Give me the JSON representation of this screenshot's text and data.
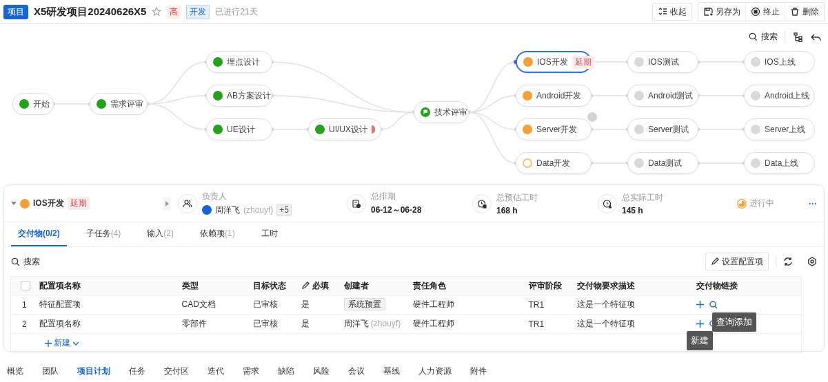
{
  "header": {
    "badge": "项目",
    "title": "X5研发项目20240626X5",
    "starred": false,
    "tags": [
      {
        "text": "高",
        "kind": "priority"
      },
      {
        "text": "开发",
        "kind": "phase"
      }
    ],
    "elapsed": "已进行21天",
    "actions": [
      {
        "label": "收起"
      },
      {
        "label": "另存为"
      },
      {
        "label": "终止"
      },
      {
        "label": "删除"
      }
    ]
  },
  "canvas_toolbar": {
    "search": "搜索"
  },
  "flow": {
    "nodes": [
      {
        "label": "开始",
        "kind": "task",
        "color": "#22a31a",
        "hollow": false,
        "selected": false,
        "warning": false,
        "comment": false
      },
      {
        "label": "需求评审",
        "kind": "task",
        "color": "#22a31a",
        "hollow": false,
        "selected": false,
        "warning": false,
        "comment": false
      },
      {
        "label": "埋点设计",
        "kind": "task",
        "color": "#22a31a",
        "hollow": false,
        "selected": false,
        "warning": false,
        "comment": false
      },
      {
        "label": "AB方案设计",
        "kind": "task",
        "color": "#22a31a",
        "hollow": false,
        "selected": false,
        "warning": false,
        "comment": false
      },
      {
        "label": "UE设计",
        "kind": "task",
        "color": "#22a31a",
        "hollow": false,
        "selected": false,
        "warning": false,
        "comment": false
      },
      {
        "label": "UI/UX设计",
        "kind": "task",
        "color": "#22a31a",
        "hollow": false,
        "selected": false,
        "warning": true,
        "comment": false
      },
      {
        "label": "技术评审",
        "kind": "milestone",
        "color": "#22a31a",
        "hollow": false,
        "selected": false,
        "warning": false,
        "comment": false
      },
      {
        "label": "IOS开发",
        "kind": "task",
        "color": "#f7a035",
        "hollow": false,
        "selected": true,
        "tag": "延期",
        "warning": false,
        "comment": false
      },
      {
        "label": "Android开发",
        "kind": "task",
        "color": "#f7a035",
        "hollow": false,
        "selected": false,
        "warning": false,
        "comment": false
      },
      {
        "label": "Server开发",
        "kind": "task",
        "color": "#f7a035",
        "hollow": false,
        "selected": false,
        "warning": false,
        "comment": true
      },
      {
        "label": "Data开发",
        "kind": "task",
        "color": "#f5c27a",
        "hollow": true,
        "selected": false,
        "warning": false,
        "comment": false
      },
      {
        "label": "IOS测试",
        "kind": "task",
        "color": "#d9d9d9",
        "hollow": false,
        "selected": false,
        "warning": false,
        "comment": false
      },
      {
        "label": "Android测试",
        "kind": "task",
        "color": "#d9d9d9",
        "hollow": false,
        "selected": false,
        "warning": false,
        "comment": false
      },
      {
        "label": "Server测试",
        "kind": "task",
        "color": "#d9d9d9",
        "hollow": false,
        "selected": false,
        "warning": false,
        "comment": false
      },
      {
        "label": "Data测试",
        "kind": "task",
        "color": "#d9d9d9",
        "hollow": false,
        "selected": false,
        "warning": false,
        "comment": false
      },
      {
        "label": "IOS上线",
        "kind": "task",
        "color": "#d9d9d9",
        "hollow": false,
        "selected": false,
        "warning": false,
        "comment": false
      },
      {
        "label": "Android上线",
        "kind": "task",
        "color": "#d9d9d9",
        "hollow": false,
        "selected": false,
        "warning": false,
        "comment": false
      },
      {
        "label": "Server上线",
        "kind": "task",
        "color": "#d9d9d9",
        "hollow": false,
        "selected": false,
        "warning": false,
        "comment": false
      },
      {
        "label": "Data上线",
        "kind": "task",
        "color": "#d9d9d9",
        "hollow": false,
        "selected": false,
        "warning": false,
        "comment": false
      }
    ]
  },
  "detail": {
    "expanded": true,
    "color": "#f7a035",
    "title": "IOS开发",
    "tag": "延期",
    "owner": {
      "label": "负责人",
      "name": "周洋飞",
      "user": "(zhouyf)",
      "more": "+5"
    },
    "stats": [
      {
        "label": "总排期",
        "value": "06-12～06-28"
      },
      {
        "label": "总预估工时",
        "value": "168 h"
      },
      {
        "label": "总实际工时",
        "value": "145 h"
      }
    ],
    "progress": {
      "label": "进行中"
    },
    "more": "···"
  },
  "tabs": [
    {
      "label": "交付物(0/2)",
      "selected": true
    },
    {
      "label": "子任务",
      "count": "(4)",
      "selected": false
    },
    {
      "label": "输入",
      "count": "(2)",
      "selected": false
    },
    {
      "label": "依赖项",
      "count": "(1)",
      "selected": false
    },
    {
      "label": "工时",
      "selected": false
    }
  ],
  "search": {
    "placeholder": "搜索"
  },
  "config_button": "设置配置项",
  "table": {
    "select_all": false,
    "columns": [
      {
        "label": "配置项名称",
        "editable": false
      },
      {
        "label": "类型",
        "editable": false
      },
      {
        "label": "目标状态",
        "editable": false
      },
      {
        "label": "必填",
        "editable": true
      },
      {
        "label": "创建者",
        "editable": false
      },
      {
        "label": "责任角色",
        "editable": false
      },
      {
        "label": "评审阶段",
        "editable": false
      },
      {
        "label": "交付物要求描述",
        "editable": false
      },
      {
        "label": "交付物链接",
        "editable": false
      }
    ],
    "rows": [
      {
        "index": "1",
        "name": "特征配置项",
        "type": "CAD文档",
        "status": "已审核",
        "required": "是",
        "creator": {
          "kind": "system",
          "name": "系统预置"
        },
        "role": "硬件工程师",
        "stage": "TR1",
        "description": "这是一个特征项"
      },
      {
        "index": "2",
        "name": "配置项名称",
        "type": "零部件",
        "status": "已审核",
        "required": "是",
        "creator": {
          "kind": "user",
          "name": "周洋飞",
          "user": "(zhouyf)"
        },
        "role": "硬件工程师",
        "stage": "TR1",
        "description": "这是一个特征项"
      }
    ],
    "add_button": "新建"
  },
  "tooltips": [
    {
      "text": "查询添加"
    },
    {
      "text": "新建"
    }
  ],
  "bottom_nav": [
    {
      "label": "概览",
      "selected": false
    },
    {
      "label": "团队",
      "selected": false
    },
    {
      "label": "项目计划",
      "selected": true
    },
    {
      "label": "任务",
      "selected": false
    },
    {
      "label": "交付区",
      "selected": false
    },
    {
      "label": "迭代",
      "selected": false
    },
    {
      "label": "需求",
      "selected": false
    },
    {
      "label": "缺陷",
      "selected": false
    },
    {
      "label": "风险",
      "selected": false
    },
    {
      "label": "会议",
      "selected": false
    },
    {
      "label": "基线",
      "selected": false
    },
    {
      "label": "人力资源",
      "selected": false
    },
    {
      "label": "附件",
      "selected": false
    }
  ]
}
